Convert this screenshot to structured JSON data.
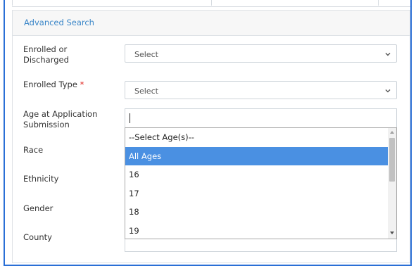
{
  "panel": {
    "title": "Advanced Search"
  },
  "fields": {
    "enrolled_or_discharged": {
      "label": "Enrolled or Discharged",
      "value": "Select"
    },
    "enrolled_type": {
      "label": "Enrolled Type",
      "required_mark": "*",
      "value": "Select"
    },
    "age_at_application": {
      "label": "Age at Application Submission",
      "value": ""
    },
    "race": {
      "label": "Race"
    },
    "ethnicity": {
      "label": "Ethnicity"
    },
    "gender": {
      "label": "Gender"
    },
    "county": {
      "label": "County"
    }
  },
  "age_dropdown": {
    "options": [
      "--Select Age(s)--",
      "All Ages",
      "16",
      "17",
      "18",
      "19"
    ],
    "highlighted": "All Ages",
    "highlight_color": "#4a90e2"
  },
  "colors": {
    "accent": "#3a86c8",
    "frame": "#2a6fd6",
    "required": "#e0211b"
  },
  "icons": {
    "select_chevron": "chevron-down-icon",
    "scroll_up": "scroll-up-arrow-icon",
    "scroll_down": "scroll-down-arrow-icon"
  }
}
